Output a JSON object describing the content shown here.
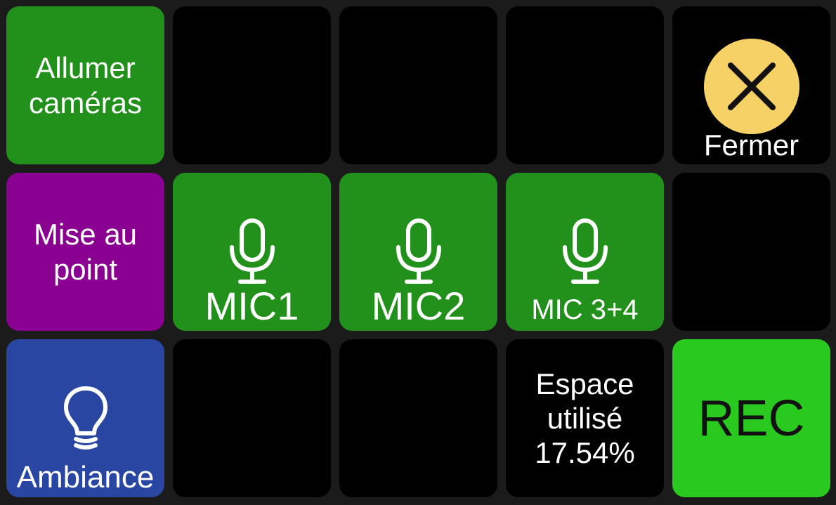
{
  "deck": {
    "keys": {
      "allumer_cameras": {
        "label": "Allumer\ncaméras",
        "color": "#22911b"
      },
      "fermer": {
        "label": "Fermer",
        "icon": "close-icon",
        "icon_color": "#f6d165"
      },
      "mise_au_point": {
        "label": "Mise au\npoint",
        "color": "#8a0090"
      },
      "mic1": {
        "label": "MIC1",
        "icon": "microphone-icon",
        "color": "#22911b"
      },
      "mic2": {
        "label": "MIC2",
        "icon": "microphone-icon",
        "color": "#22911b"
      },
      "mic34": {
        "label": "MIC 3+4",
        "icon": "microphone-icon",
        "color": "#22911b"
      },
      "ambiance": {
        "label": "Ambiance",
        "icon": "lightbulb-icon",
        "color": "#2a46a3"
      },
      "espace": {
        "label": "Espace\nutilisé\n17.54%"
      },
      "rec": {
        "label": "REC",
        "color": "#2ac920"
      }
    }
  }
}
